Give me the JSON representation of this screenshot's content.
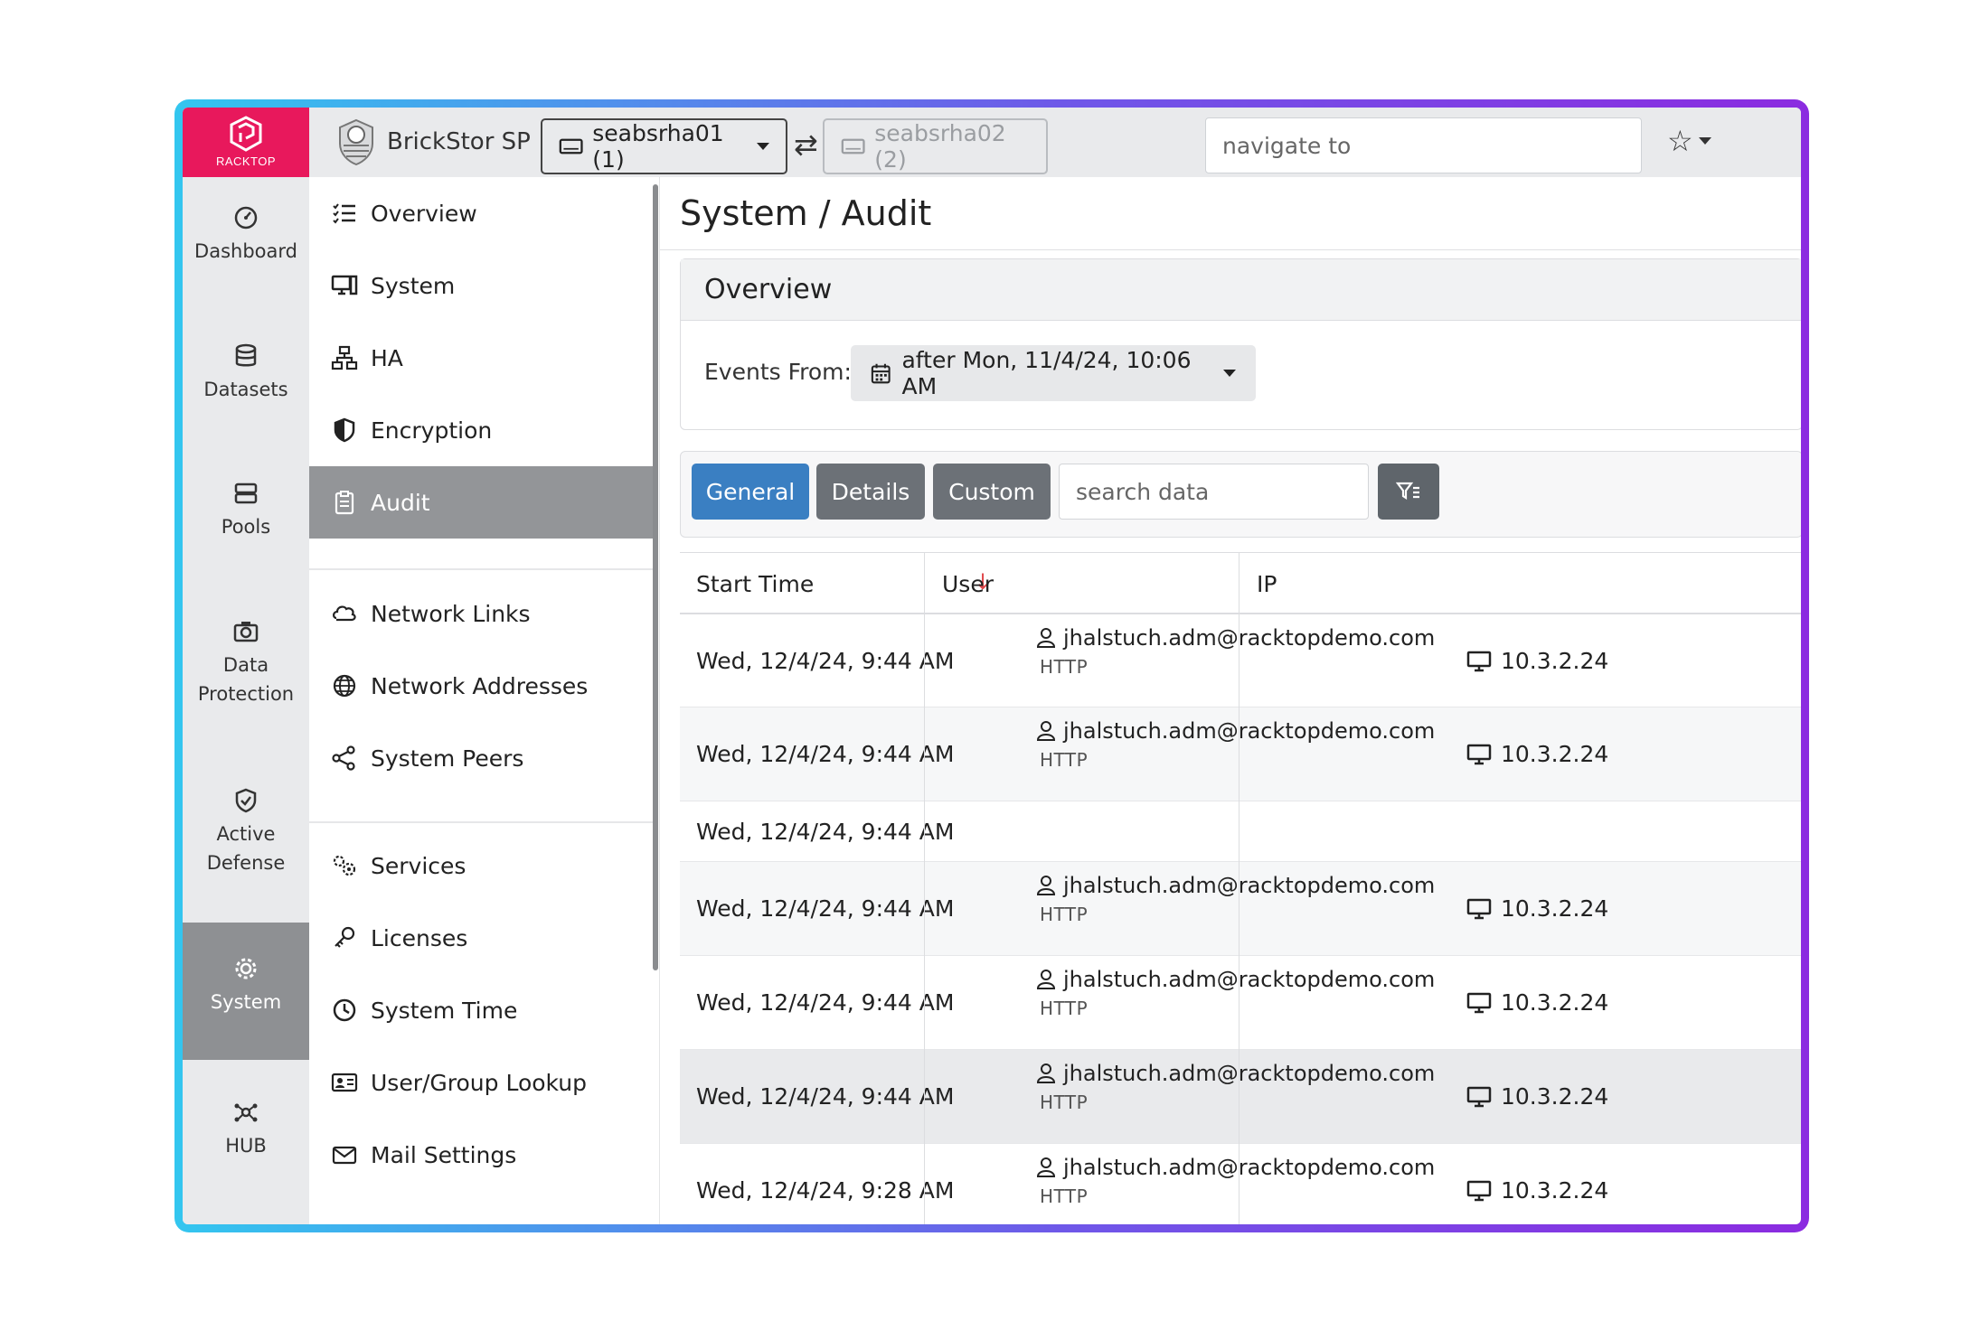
{
  "app": {
    "logo_text": "RACKTOP",
    "brand_title": "BrickStor SP",
    "host_primary": "seabsrha01 (1)",
    "host_secondary": "seabsrha02 (2)",
    "navigate_placeholder": "navigate to"
  },
  "rail": {
    "items": [
      {
        "label": "Dashboard",
        "icon": "dashboard-icon"
      },
      {
        "label": "Datasets",
        "icon": "database-icon"
      },
      {
        "label": "Pools",
        "icon": "server-icon"
      },
      {
        "label_line1": "Data",
        "label_line2": "Protection",
        "icon": "camera-icon"
      },
      {
        "label_line1": "Active",
        "label_line2": "Defense",
        "icon": "shield-check-icon"
      },
      {
        "label": "System",
        "icon": "gear-icon",
        "active": true
      },
      {
        "label": "HUB",
        "icon": "hub-icon"
      }
    ]
  },
  "subnav": {
    "items": [
      {
        "label": "Overview",
        "icon": "list-icon"
      },
      {
        "label": "System",
        "icon": "monitor-icon"
      },
      {
        "label": "HA",
        "icon": "network-tree-icon"
      },
      {
        "label": "Encryption",
        "icon": "shield-half-icon"
      },
      {
        "label": "Audit",
        "icon": "clipboard-icon",
        "active": true
      },
      {
        "label": "Network Links",
        "icon": "cloud-link-icon"
      },
      {
        "label": "Network Addresses",
        "icon": "globe-icon"
      },
      {
        "label": "System Peers",
        "icon": "share-icon"
      },
      {
        "label": "Services",
        "icon": "gears-icon"
      },
      {
        "label": "Licenses",
        "icon": "key-icon"
      },
      {
        "label": "System Time",
        "icon": "clock-icon"
      },
      {
        "label": "User/Group Lookup",
        "icon": "id-card-icon"
      },
      {
        "label": "Mail Settings",
        "icon": "envelope-icon"
      }
    ]
  },
  "main": {
    "page_title": "System / Audit",
    "overview_header": "Overview",
    "events_from_label": "Events From:",
    "events_from_value": "after Mon, 11/4/24, 10:06 AM",
    "tabs": [
      "General",
      "Details",
      "Custom"
    ],
    "search_placeholder": "search data",
    "table": {
      "columns": [
        "Start Time",
        "User",
        "IP"
      ],
      "rows": [
        {
          "time": "Wed, 12/4/24, 9:44 AM",
          "user": "jhalstuch.adm@racktopdemo.com",
          "proto": "HTTP",
          "ip": "10.3.2.24"
        },
        {
          "time": "Wed, 12/4/24, 9:44 AM",
          "user": "jhalstuch.adm@racktopdemo.com",
          "proto": "HTTP",
          "ip": "10.3.2.24"
        },
        {
          "time": "Wed, 12/4/24, 9:44 AM",
          "user": "",
          "proto": "",
          "ip": ""
        },
        {
          "time": "Wed, 12/4/24, 9:44 AM",
          "user": "jhalstuch.adm@racktopdemo.com",
          "proto": "HTTP",
          "ip": "10.3.2.24"
        },
        {
          "time": "Wed, 12/4/24, 9:44 AM",
          "user": "jhalstuch.adm@racktopdemo.com",
          "proto": "HTTP",
          "ip": "10.3.2.24"
        },
        {
          "time": "Wed, 12/4/24, 9:44 AM",
          "user": "jhalstuch.adm@racktopdemo.com",
          "proto": "HTTP",
          "ip": "10.3.2.24"
        },
        {
          "time": "Wed, 12/4/24, 9:28 AM",
          "user": "jhalstuch.adm@racktopdemo.com",
          "proto": "HTTP",
          "ip": "10.3.2.24"
        }
      ]
    }
  },
  "colors": {
    "brand_red": "#e8185c",
    "primary_blue": "#3a7fc2",
    "secondary_gray": "#6c7177",
    "frame_gradient_start": "#33c6ef",
    "frame_gradient_end": "#8b2be0"
  }
}
